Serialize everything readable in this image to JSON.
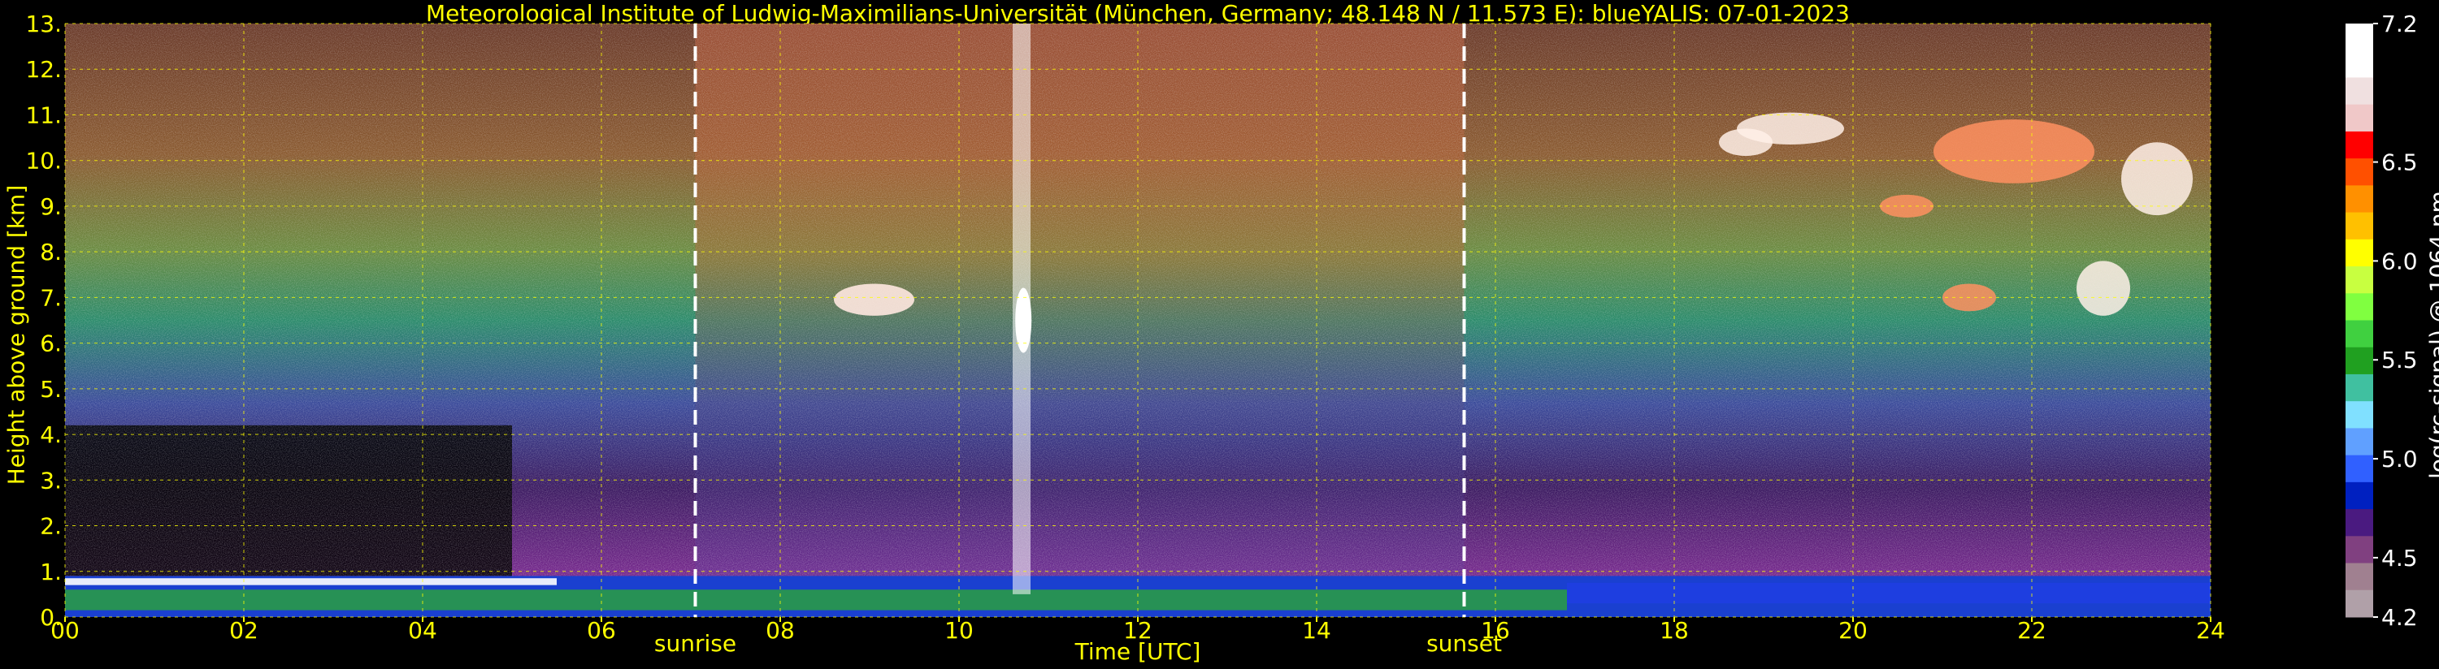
{
  "chart_data": {
    "type": "heatmap",
    "title": "Meteorological Institute of Ludwig-Maximilians-Universität (München, Germany; 48.148 N / 11.573 E):     blueYALIS: 07-01-2023",
    "xlabel": "Time [UTC]",
    "ylabel": "Height above ground [km]",
    "xlim": [
      0,
      24
    ],
    "ylim": [
      0,
      13
    ],
    "x_ticks": [
      "00",
      "02",
      "04",
      "06",
      "08",
      "10",
      "12",
      "14",
      "16",
      "18",
      "20",
      "22",
      "24"
    ],
    "y_ticks": [
      "0.",
      "1.",
      "2.",
      "3.",
      "4.",
      "5.",
      "6.",
      "7.",
      "8.",
      "9.",
      "10.",
      "11.",
      "12.",
      "13."
    ],
    "grid": true,
    "markers": [
      {
        "label": "sunrise",
        "x": 7.05
      },
      {
        "label": "sunset",
        "x": 15.65
      }
    ],
    "colorbar": {
      "label": "log(rc-signal) @ 1064 nm",
      "range": [
        4.2,
        7.2
      ],
      "ticks": [
        "4.2",
        "4.5",
        "5.0",
        "5.5",
        "6.0",
        "6.5",
        "7.2"
      ]
    },
    "features": [
      {
        "name": "boundary layer",
        "x": [
          0,
          24
        ],
        "height_km": [
          0,
          0.9
        ]
      },
      {
        "name": "midlevel cloud",
        "x": [
          8.6,
          9.5
        ],
        "height_km": [
          6.6,
          7.3
        ]
      },
      {
        "name": "precipitation streak",
        "x": [
          10.6,
          10.8
        ],
        "height_km": [
          0.5,
          13
        ]
      },
      {
        "name": "cirrus cloud",
        "x": [
          17.5,
          24
        ],
        "height_km": [
          5.5,
          11.2
        ]
      }
    ]
  },
  "colors": {
    "axis_text": "#ffff00",
    "grid": "#ffff00",
    "marker_line": "#ffffff",
    "background": "#000000"
  }
}
